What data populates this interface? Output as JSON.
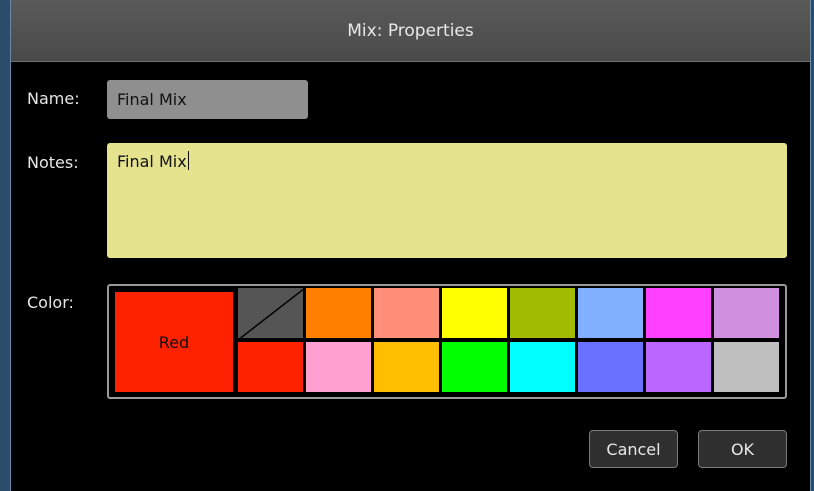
{
  "window": {
    "title": "Mix: Properties"
  },
  "form": {
    "name_label": "Name:",
    "name_value": "Final Mix",
    "notes_label": "Notes:",
    "notes_value": "Final Mix",
    "color_label": "Color:"
  },
  "palette": {
    "selected_name": "Red",
    "selected_color": "#ff2200",
    "swatches": [
      "none",
      "#ff7f00",
      "#ff8f78",
      "#ffff00",
      "#a0bb00",
      "#80b0ff",
      "#ff40ff",
      "#d090e0",
      "#ff2200",
      "#ffa0d0",
      "#ffbf00",
      "#00ff00",
      "#00ffff",
      "#6a70ff",
      "#bb66ff",
      "#bfbfbf"
    ]
  },
  "buttons": {
    "cancel": "Cancel",
    "ok": "OK"
  }
}
